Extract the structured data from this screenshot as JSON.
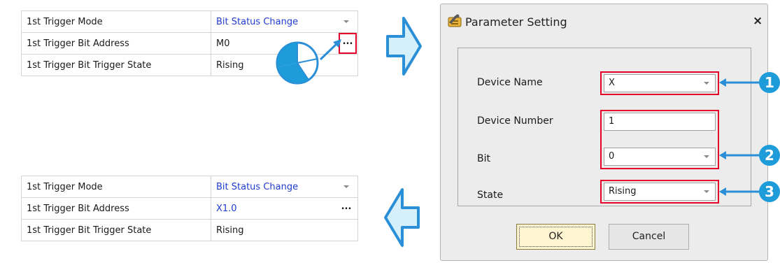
{
  "top_table": {
    "rows": [
      {
        "label": "1st Trigger Mode",
        "value": "Bit Status Change"
      },
      {
        "label": "1st Trigger Bit Address",
        "value": "M0",
        "button": "..."
      },
      {
        "label": "1st Trigger Bit Trigger State",
        "value": "Rising"
      }
    ]
  },
  "bottom_table": {
    "rows": [
      {
        "label": "1st Trigger Mode",
        "value": "Bit Status Change"
      },
      {
        "label": "1st Trigger Bit Address",
        "value": "X1.0",
        "button": "..."
      },
      {
        "label": "1st Trigger Bit Trigger State",
        "value": "Rising"
      }
    ]
  },
  "dialog": {
    "title": "Parameter Setting",
    "close": "×",
    "fields": {
      "device_name": {
        "label": "Device Name",
        "value": "X"
      },
      "device_number": {
        "label": "Device Number",
        "value": "1"
      },
      "bit": {
        "label": "Bit",
        "value": "0"
      },
      "state": {
        "label": "State",
        "value": "Rising"
      }
    },
    "ok_label": "OK",
    "cancel_label": "Cancel"
  },
  "callouts": [
    "1",
    "2",
    "3"
  ],
  "colors": {
    "callout": "#1e9bd9",
    "highlight": "#e4002b",
    "arrow_fill": "#d6f0fb",
    "value_blue": "#1f3ccf"
  }
}
